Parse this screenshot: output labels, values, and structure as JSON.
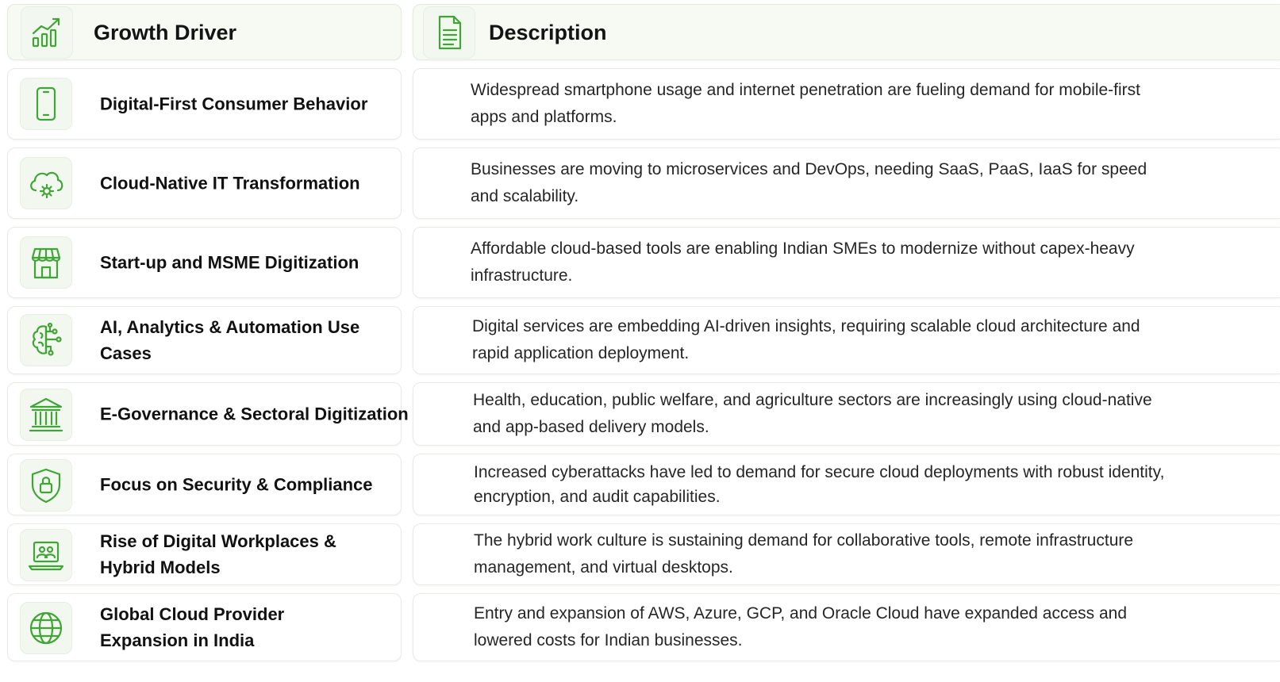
{
  "header": {
    "driver_title": "Growth Driver",
    "description_title": "Description",
    "driver_icon": "growth-chart-icon",
    "description_icon": "document-icon"
  },
  "accent_color": "#3fa535",
  "rows": [
    {
      "driver": "Digital-First Consumer Behavior",
      "description": "Widespread smartphone usage and internet penetration are fueling demand for mobile-first apps and platforms.",
      "icon": "smartphone-icon"
    },
    {
      "driver": "Cloud-Native IT Transformation",
      "description": "Businesses are moving to microservices and DevOps, needing SaaS, PaaS, IaaS for speed and scalability.",
      "icon": "cloud-gear-icon"
    },
    {
      "driver": "Start-up and MSME Digitization",
      "description": "Affordable cloud-based tools are enabling Indian SMEs to modernize without capex-heavy infrastructure.",
      "icon": "storefront-icon"
    },
    {
      "driver": "AI, Analytics & Automation Use Cases",
      "description": "Digital services are embedding AI-driven insights, requiring scalable cloud architecture and rapid application deployment.",
      "icon": "ai-brain-icon"
    },
    {
      "driver": "E-Governance & Sectoral Digitization",
      "description": "Health, education, public welfare, and agriculture sectors are increasingly using cloud-native and app-based delivery models.",
      "icon": "government-building-icon"
    },
    {
      "driver": "Focus on Security & Compliance",
      "description": "Increased cyberattacks have led to demand for secure cloud deployments with robust identity, encryption, and audit capabilities.",
      "icon": "shield-lock-icon"
    },
    {
      "driver": "Rise of Digital Workplaces & Hybrid Models",
      "description": "The hybrid work culture is sustaining demand for collaborative tools, remote infrastructure management, and virtual desktops.",
      "icon": "laptop-users-icon"
    },
    {
      "driver": "Global Cloud Provider Expansion in India",
      "description": "Entry and expansion of AWS, Azure, GCP, and Oracle Cloud have expanded access and lowered costs for Indian businesses.",
      "icon": "globe-icon"
    }
  ]
}
